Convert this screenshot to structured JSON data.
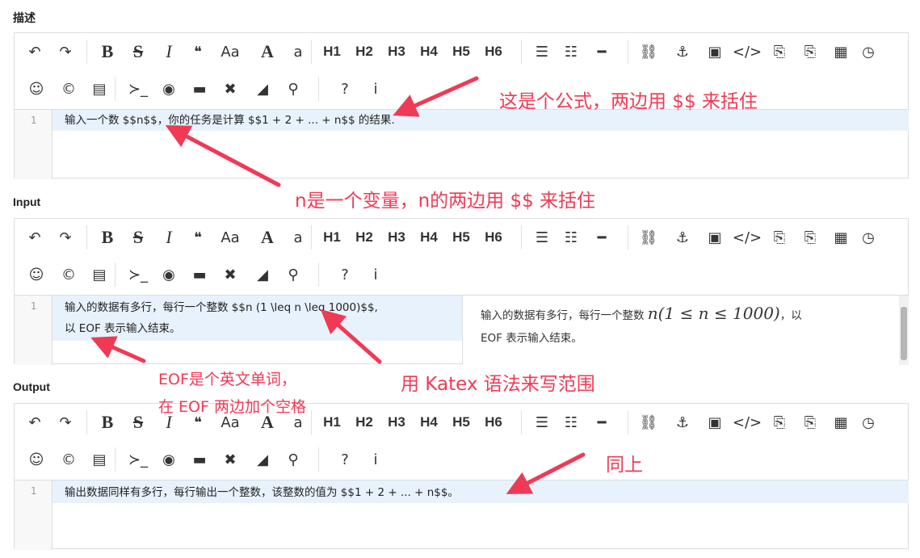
{
  "sections": {
    "description": {
      "label": "描述",
      "code_line": "输入一个数 $$n$$，你的任务是计算 $$1 + 2 + ... + n$$ 的结果."
    },
    "input": {
      "label": "Input",
      "code_line_1": "输入的数据有多行，每行一个整数 $$n (1 \\leq n \\leq 1000)$$,",
      "code_line_2": "以 EOF 表示输入结束。",
      "preview_part1": "输入的数据有多行，每行一个整数",
      "preview_math": "n(1 ≤ n ≤ 1000)",
      "preview_part2": "，以",
      "preview_line2": "EOF 表示输入结束。"
    },
    "output": {
      "label": "Output",
      "code_line": "输出数据同样有多行，每行输出一个整数，该整数的值为 $$1 + 2 + ... + n$$。"
    }
  },
  "line_number": "1",
  "toolbar": {
    "row1": [
      {
        "name": "undo-icon",
        "glyph": "↶"
      },
      {
        "name": "redo-icon",
        "glyph": "↷"
      },
      {
        "name": "bold-icon",
        "glyph": "B"
      },
      {
        "name": "strikethrough-icon",
        "glyph": "S"
      },
      {
        "name": "italic-icon",
        "glyph": "I"
      },
      {
        "name": "quote-icon",
        "glyph": "❝"
      },
      {
        "name": "uppercase-icon",
        "glyph": "Aa"
      },
      {
        "name": "font-a-icon",
        "glyph": "A"
      },
      {
        "name": "lowercase-icon",
        "glyph": "a"
      },
      {
        "name": "h1-icon",
        "glyph": "H1"
      },
      {
        "name": "h2-icon",
        "glyph": "H2"
      },
      {
        "name": "h3-icon",
        "glyph": "H3"
      },
      {
        "name": "h4-icon",
        "glyph": "H4"
      },
      {
        "name": "h5-icon",
        "glyph": "H5"
      },
      {
        "name": "h6-icon",
        "glyph": "H6"
      },
      {
        "name": "unordered-list-icon",
        "glyph": "☰"
      },
      {
        "name": "ordered-list-icon",
        "glyph": "☷"
      },
      {
        "name": "horizontal-rule-icon",
        "glyph": "━"
      },
      {
        "name": "link-icon",
        "glyph": "⛓"
      },
      {
        "name": "anchor-icon",
        "glyph": "⚓"
      },
      {
        "name": "image-icon",
        "glyph": "▣"
      },
      {
        "name": "code-icon",
        "glyph": "</>"
      },
      {
        "name": "code-block-icon",
        "glyph": "⎘"
      },
      {
        "name": "code-file-icon",
        "glyph": "⎘"
      },
      {
        "name": "table-icon",
        "glyph": "▦"
      },
      {
        "name": "clock-icon",
        "glyph": "◷"
      }
    ],
    "row2": [
      {
        "name": "emoji-icon",
        "glyph": "☺"
      },
      {
        "name": "copyright-icon",
        "glyph": "©"
      },
      {
        "name": "template-icon",
        "glyph": "▤"
      },
      {
        "name": "terminal-icon",
        "glyph": "≻_"
      },
      {
        "name": "preview-eye-icon",
        "glyph": "◉"
      },
      {
        "name": "desktop-icon",
        "glyph": "▬"
      },
      {
        "name": "fullscreen-icon",
        "glyph": "✖"
      },
      {
        "name": "eraser-icon",
        "glyph": "◢"
      },
      {
        "name": "search-icon",
        "glyph": "⚲"
      },
      {
        "name": "help-icon",
        "glyph": "?"
      },
      {
        "name": "info-icon",
        "glyph": "i"
      }
    ]
  },
  "annotations": {
    "formula": "这是个公式，两边用 $$ 来括住",
    "variable": "n是一个变量，n的两边用 $$ 来括住",
    "eof_line1": "EOF是个英文单词，",
    "eof_line2": "在 EOF 两边加个空格",
    "katex": "用 Katex 语法来写范围",
    "same": "同上"
  },
  "colors": {
    "annotation": "#f03a55",
    "highlight": "#e8f2fc"
  }
}
